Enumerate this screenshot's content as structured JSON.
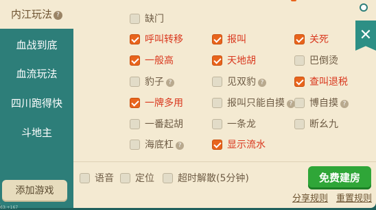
{
  "sidebar": {
    "items": [
      {
        "label": "内江玩法",
        "help": "?"
      },
      {
        "label": "血战到底"
      },
      {
        "label": "血流玩法"
      },
      {
        "label": "四川跑得快"
      },
      {
        "label": "斗地主"
      }
    ],
    "add_game_label": "添加游戏"
  },
  "options": {
    "que_men": {
      "label": "缺门",
      "checked": false
    },
    "hu_jiao_zhuan_yi": {
      "label": "呼叫转移",
      "checked": true
    },
    "bao_jiao": {
      "label": "报叫",
      "checked": true
    },
    "guan_si": {
      "label": "关死",
      "checked": true
    },
    "yi_ban_gao": {
      "label": "一般高",
      "checked": true
    },
    "tian_di_hu": {
      "label": "天地胡",
      "checked": true
    },
    "ba_dao_tang": {
      "label": "巴倒烫",
      "checked": false
    },
    "bao_zi": {
      "label": "豹子",
      "checked": false,
      "help": "?"
    },
    "jian_shuang_bao": {
      "label": "见双豹",
      "checked": false,
      "help": "?"
    },
    "cha_jiao_tui_shui": {
      "label": "查叫退税",
      "checked": true
    },
    "yi_pai_duo_yong": {
      "label": "一牌多用",
      "checked": true
    },
    "bao_jiao_zhi_neng_zi_mo": {
      "label": "报叫只能自摸",
      "checked": false,
      "help": "?"
    },
    "bo_zi_mo": {
      "label": "博自摸",
      "checked": false,
      "help": "?"
    },
    "yi_fan_qi_hu": {
      "label": "一番起胡",
      "checked": false
    },
    "yi_tiao_long": {
      "label": "一条龙",
      "checked": false
    },
    "duan_yao_jiu": {
      "label": "断幺九",
      "checked": false
    },
    "hai_di_gang": {
      "label": "海底杠",
      "checked": false,
      "help": "?"
    },
    "xian_shi_liu_shui": {
      "label": "显示流水",
      "checked": true
    }
  },
  "bottom": {
    "voice_label": "语音",
    "location_label": "定位",
    "timeout_label": "超时解散(5分钟)",
    "create_label": "免费建房",
    "share_rules_label": "分享规则",
    "reset_rules_label": "重置规则"
  },
  "close_glyph": "✕",
  "status_text": "63:+167",
  "colors": {
    "sidebar": "#2d7e79",
    "panel": "#f4ead2",
    "checked": "#e8641c",
    "create": "#2fa638",
    "selected_text": "#d9371d"
  }
}
